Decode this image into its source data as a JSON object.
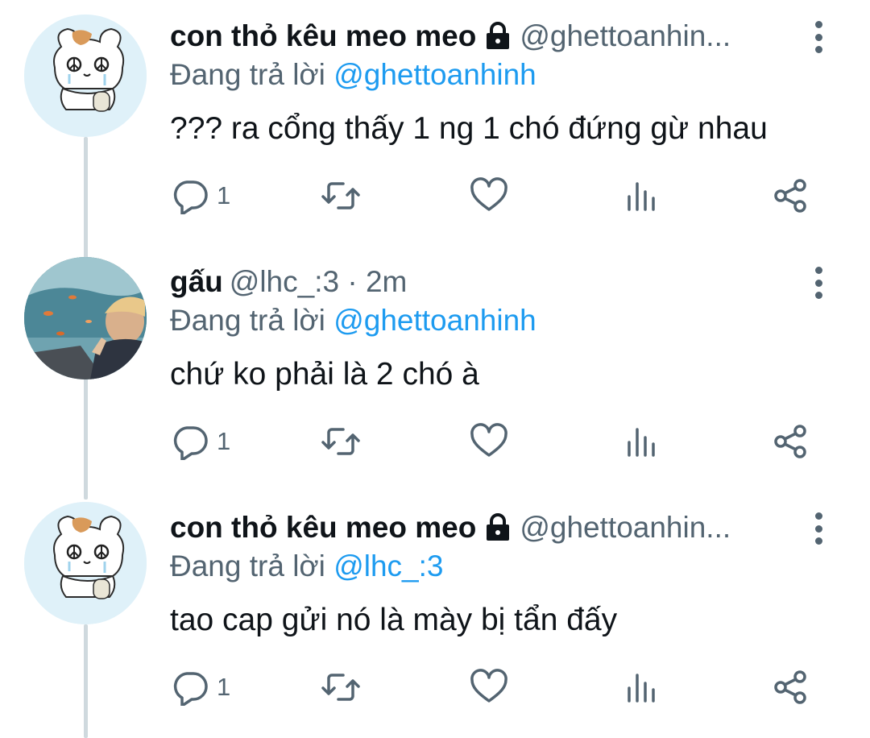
{
  "colors": {
    "text": "#0f1419",
    "secondary": "#536471",
    "mention": "#1d9bf0",
    "thread": "#cfd9de",
    "avatar_bg": "#dff1f9"
  },
  "icons": [
    "more-vertical-icon",
    "lock-icon",
    "reply-icon",
    "retweet-icon",
    "like-icon",
    "views-icon",
    "share-icon"
  ],
  "tweets": [
    {
      "avatar": "bunny-avatar",
      "name": "con thỏ kêu meo meo",
      "protected": true,
      "handle": "@ghettoanhin...",
      "replying_prefix": "Đang trả lời",
      "replying_to": "@ghettoanhinh",
      "text": "??? ra cổng thấy 1 ng 1 chó đứng gừ nhau",
      "replies": "1"
    },
    {
      "avatar": "photo-avatar",
      "name": "gấu",
      "protected": false,
      "handle": "@lhc_:3 · 2m",
      "replying_prefix": "Đang trả lời",
      "replying_to": "@ghettoanhinh",
      "text": "chứ ko phải là 2 chó à",
      "replies": "1"
    },
    {
      "avatar": "bunny-avatar",
      "name": "con thỏ kêu meo meo",
      "protected": true,
      "handle": "@ghettoanhin...",
      "replying_prefix": "Đang trả lời",
      "replying_to": "@lhc_:3",
      "text": "tao cap gửi nó là mày bị tẩn đấy",
      "replies": "1"
    }
  ]
}
